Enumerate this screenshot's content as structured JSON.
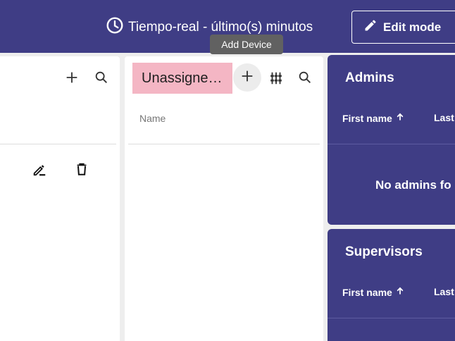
{
  "header": {
    "time_window_label": "Tiempo-real - último(s) minutos",
    "edit_mode_label": "Edit mode"
  },
  "tooltip": {
    "text": "Add Device"
  },
  "devices_panel": {
    "filter_chip_label": "Unassigne…",
    "column_name": "Name"
  },
  "admins": {
    "title": "Admins",
    "col_first_name": "First name",
    "col_last_name": "Last",
    "empty_text": "No admins fo"
  },
  "supervisors": {
    "title": "Supervisors",
    "col_first_name": "First name",
    "col_last_name": "Last"
  },
  "colors": {
    "primary": "#3f3d85",
    "chip": "#f4b6c4",
    "tooltip": "#616161"
  }
}
